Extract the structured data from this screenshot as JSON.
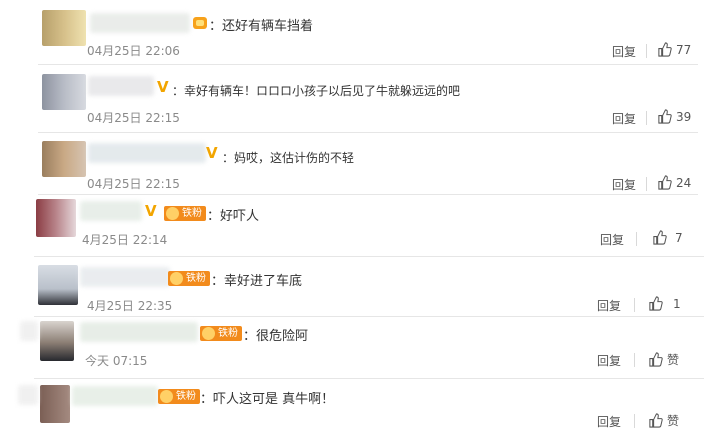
{
  "comments": [
    {
      "text": "：还好有辆车挡着",
      "time": "04月25日 22:06",
      "reply": "回复",
      "likes": "77"
    },
    {
      "text": "：幸好有辆车！ロロロ小孩子以后见了牛就躲远远的吧",
      "time": "04月25日 22:15",
      "reply": "回复",
      "likes": "39"
    },
    {
      "text": "：妈哎，这估计伤的不轻",
      "time": "04月25日 22:15",
      "reply": "回复",
      "likes": "24"
    },
    {
      "text": "：好吓人",
      "time": "4月25日 22:14",
      "reply": "回复",
      "likes": "7",
      "badge": "铁粉"
    },
    {
      "text": "：幸好进了车底",
      "time": "4月25日 22:35",
      "reply": "回复",
      "likes": "1",
      "badge": "铁粉"
    },
    {
      "text": "：很危险阿",
      "time": "今天 07:15",
      "reply": "回复",
      "likes": "赞",
      "badge": "铁粉"
    },
    {
      "text": "：吓人这可是  真牛啊！",
      "time": "",
      "reply": "回复",
      "likes": "赞",
      "badge": "铁粉"
    }
  ],
  "vip_mark": "V",
  "icons": {
    "like": "thumbs-up-icon"
  }
}
